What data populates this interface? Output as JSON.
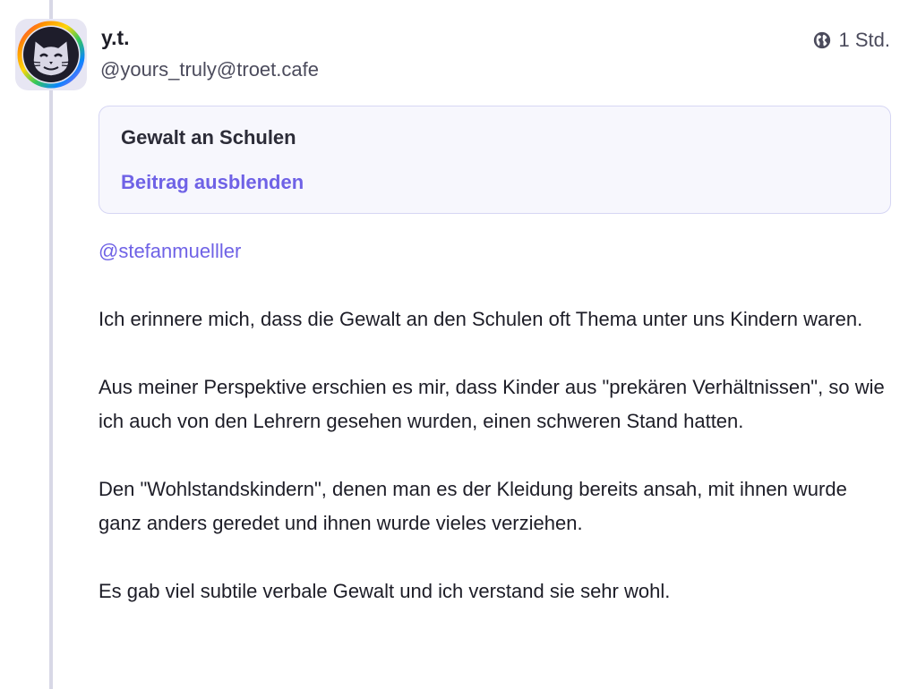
{
  "author": {
    "display_name": "y.t.",
    "handle": "@yours_truly@troet.cafe"
  },
  "meta": {
    "visibility_icon": "globe-icon",
    "relative_time": "1 Std."
  },
  "content_warning": {
    "title": "Gewalt an Schulen",
    "toggle_label": "Beitrag ausblenden"
  },
  "post": {
    "mention": "@stefanmuelller",
    "paragraphs": [
      "Ich erinnere mich, dass die Gewalt an den Schulen oft Thema unter uns Kindern waren.",
      "Aus meiner Perspektive erschien es mir, dass Kinder aus \"prekären Verhältnissen\", so wie ich auch von den Lehrern gesehen wurden, einen schweren Stand hatten.",
      "Den \"Wohlstandskindern\", denen man es der Kleidung bereits ansah, mit ihnen wurde ganz anders geredet und ihnen wurde vieles verziehen.",
      "Es gab viel subtile verbale Gewalt und ich verstand sie sehr wohl."
    ]
  },
  "colors": {
    "accent": "#6f62e6",
    "thread_line": "#d8d8e6",
    "cw_background": "#f7f7fd",
    "cw_border": "#d6d6f4"
  }
}
